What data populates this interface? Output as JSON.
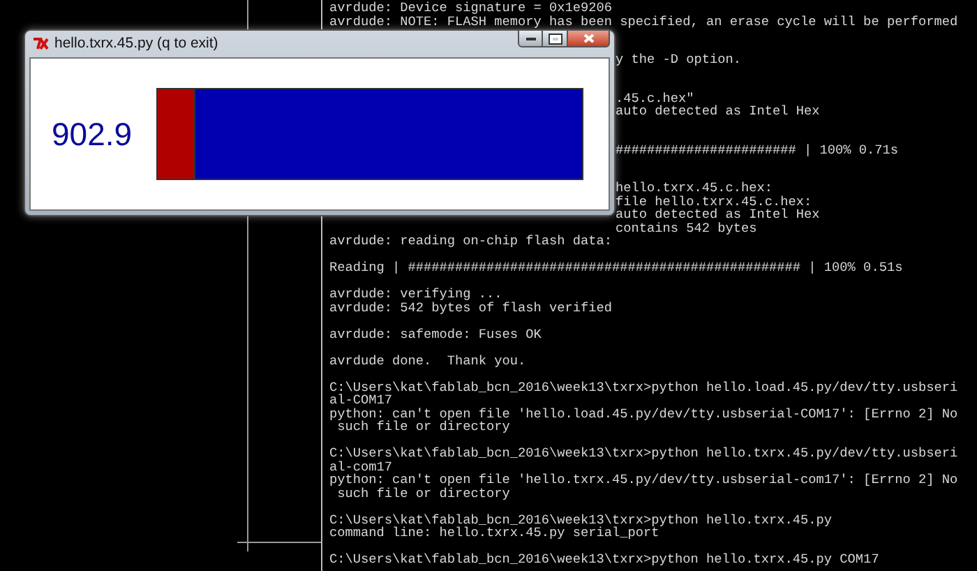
{
  "window": {
    "title": "hello.txrx.45.py (q to exit)",
    "reading": "902.9",
    "bar": {
      "level": 0.09
    }
  },
  "terminal": {
    "blocks": [
      {
        "lines": [
          {
            "text": "avrdude: Device signature = 0x1e9206",
            "covered": false
          },
          {
            "text": "avrdude: NOTE: FLASH memory has been specified, an erase cycle will be performed",
            "covered": false
          }
        ]
      },
      {
        "lines": [
          {
            "text": "y the -D option.",
            "covered": true
          }
        ]
      },
      {
        "lines": [
          {
            "text": ".45.c.hex\"",
            "covered": true
          },
          {
            "text": "auto detected as Intel Hex",
            "covered": true
          }
        ]
      },
      {
        "lines": [
          {
            "text": "####################### | 100% 0.71s",
            "covered": true
          }
        ]
      },
      {
        "lines": [
          {
            "text": "hello.txrx.45.c.hex:",
            "covered": true
          },
          {
            "text": "file hello.txrx.45.c.hex:",
            "covered": true
          },
          {
            "text": "auto detected as Intel Hex",
            "covered": true
          },
          {
            "text": "contains 542 bytes",
            "covered": true
          },
          {
            "text": "avrdude: reading on-chip flash data:",
            "covered": false
          }
        ]
      },
      {
        "lines": [
          {
            "text": "Reading | ################################################## | 100% 0.51s",
            "covered": false
          }
        ]
      },
      {
        "lines": [
          {
            "text": "avrdude: verifying ...",
            "covered": false
          },
          {
            "text": "avrdude: 542 bytes of flash verified",
            "covered": false
          }
        ]
      },
      {
        "lines": [
          {
            "text": "avrdude: safemode: Fuses OK",
            "covered": false
          }
        ]
      },
      {
        "lines": [
          {
            "text": "avrdude done.  Thank you.",
            "covered": false
          }
        ]
      },
      {
        "lines": [
          {
            "text": "C:\\Users\\kat\\fablab_bcn_2016\\week13\\txrx>python hello.load.45.py/dev/tty.usbseri",
            "covered": false
          },
          {
            "text": "al-COM17",
            "covered": false
          },
          {
            "text": "python: can't open file 'hello.load.45.py/dev/tty.usbserial-COM17': [Errno 2] No",
            "covered": false
          },
          {
            "text": " such file or directory",
            "covered": false
          }
        ]
      },
      {
        "lines": [
          {
            "text": "C:\\Users\\kat\\fablab_bcn_2016\\week13\\txrx>python hello.txrx.45.py/dev/tty.usbseri",
            "covered": false
          },
          {
            "text": "al-com17",
            "covered": false
          },
          {
            "text": "python: can't open file 'hello.txrx.45.py/dev/tty.usbserial-com17': [Errno 2] No",
            "covered": false
          },
          {
            "text": " such file or directory",
            "covered": false
          }
        ]
      },
      {
        "lines": [
          {
            "text": "C:\\Users\\kat\\fablab_bcn_2016\\week13\\txrx>python hello.txrx.45.py",
            "covered": false
          },
          {
            "text": "command line: hello.txrx.45.py serial_port",
            "covered": false
          }
        ]
      },
      {
        "lines": [
          {
            "text": "C:\\Users\\kat\\fablab_bcn_2016\\week13\\txrx>python hello.txrx.45.py COM17",
            "covered": false
          }
        ]
      }
    ]
  }
}
